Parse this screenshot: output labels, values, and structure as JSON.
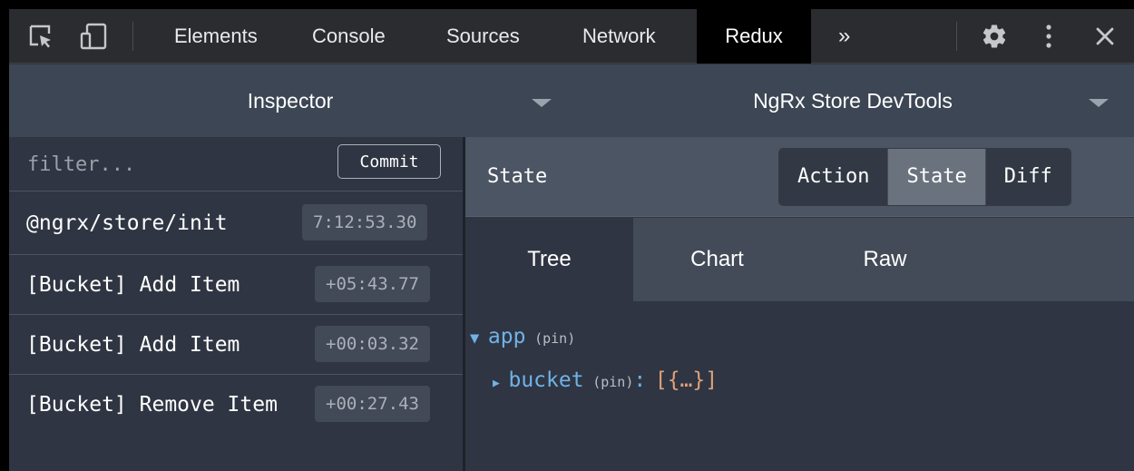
{
  "toolbar": {
    "icons": [
      "inspect-element-icon",
      "device-toggle-icon",
      "settings-gear-icon",
      "more-vertical-icon",
      "close-icon"
    ],
    "tabs": [
      "Elements",
      "Console",
      "Sources",
      "Network",
      "Redux"
    ],
    "active_tab": "Redux",
    "overflow": "»"
  },
  "subbar": {
    "left_label": "Inspector",
    "right_label": "NgRx Store DevTools"
  },
  "actions": {
    "filter_placeholder": "filter...",
    "commit_label": "Commit",
    "items": [
      {
        "name": "@ngrx/store/init",
        "time": "7:12:53.30"
      },
      {
        "name": "[Bucket] Add Item",
        "time": "+05:43.77"
      },
      {
        "name": "[Bucket] Add Item",
        "time": "+00:03.32"
      },
      {
        "name": "[Bucket] Remove Item",
        "time": "+00:27.43"
      }
    ]
  },
  "monitor": {
    "title": "State",
    "segments": [
      "Action",
      "State",
      "Diff"
    ],
    "active_segment": "State",
    "view_tabs": [
      "Tree",
      "Chart",
      "Raw"
    ],
    "active_view": "Tree"
  },
  "tree": {
    "root_key": "app",
    "root_pin": "(pin)",
    "child_key": "bucket",
    "child_pin": "(pin)",
    "child_colon": ":",
    "child_value": "[{…}]"
  },
  "colors": {
    "accent_key": "#6fb3e8",
    "value": "#e0a07a",
    "background": "#2f3542"
  }
}
